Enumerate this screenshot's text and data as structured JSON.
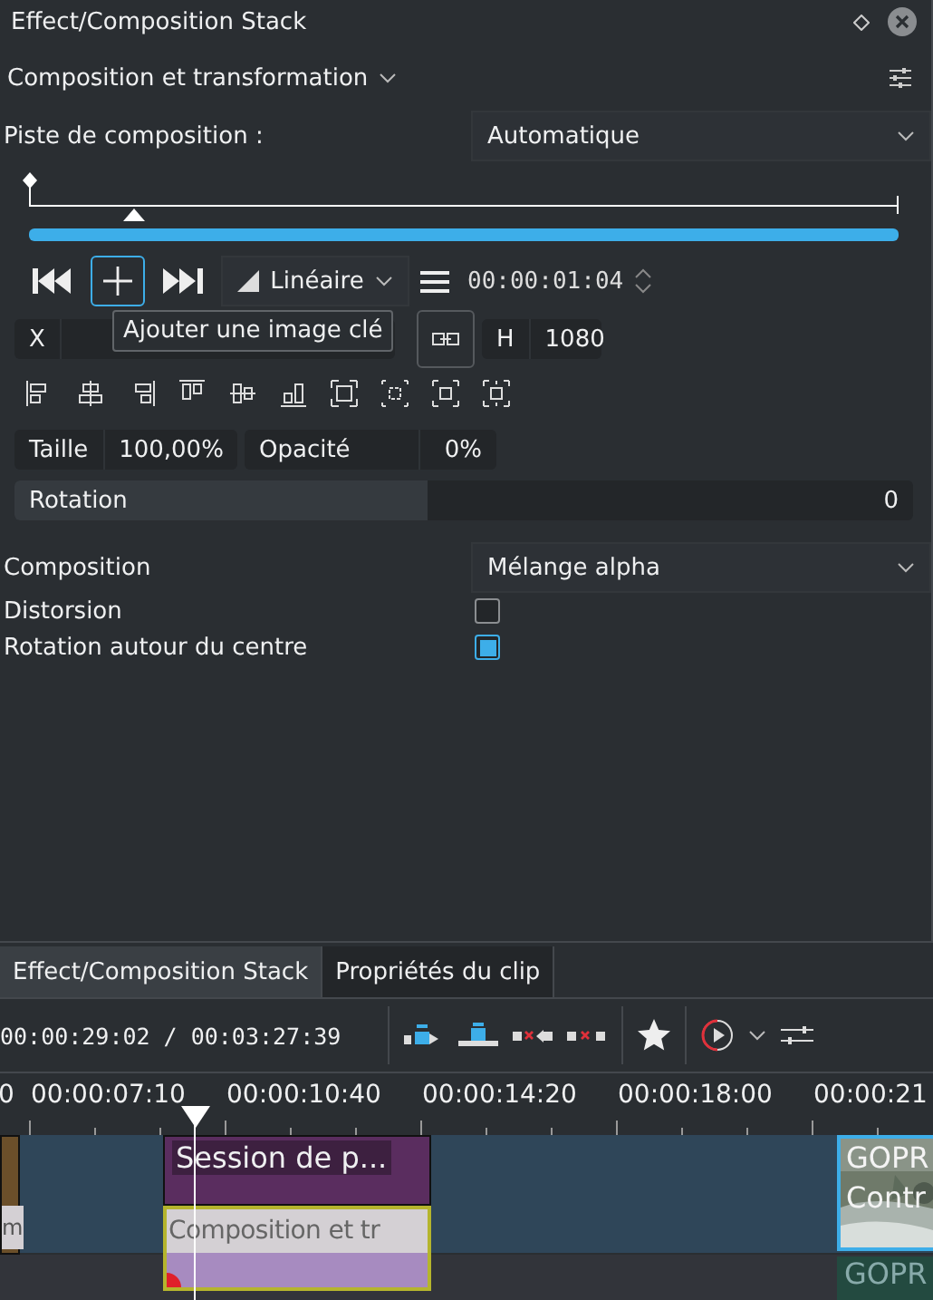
{
  "panel": {
    "title": "Effect/Composition Stack",
    "effect": {
      "name": "Composition et transformation"
    },
    "track": {
      "label": "Piste de composition :",
      "value": "Automatique"
    },
    "keyframe_ruler": {
      "level": 0.12
    },
    "keyframe_toolbar": {
      "interpolation": "Linéaire",
      "timecode": "00:00:01:04",
      "tooltip": "Ajouter une image clé"
    },
    "geometry": {
      "x_label": "X",
      "h_label": "H",
      "h_value": "1080"
    },
    "size": {
      "label": "Taille",
      "value": "100,00%"
    },
    "opacity": {
      "label": "Opacité",
      "value": "0%"
    },
    "rotation": {
      "label": "Rotation",
      "value": "0",
      "level": 0.46
    },
    "composition": {
      "label": "Composition",
      "value": "Mélange alpha"
    },
    "options": [
      {
        "label": "Distorsion",
        "checked": false
      },
      {
        "label": "Rotation autour du centre",
        "checked": true
      }
    ]
  },
  "tabs": [
    {
      "label": "Effect/Composition Stack",
      "selected": true
    },
    {
      "label": "Propriétés du clip",
      "selected": false
    }
  ],
  "timeline": {
    "timecode": "00:00:29:02 / 00:03:27:39",
    "ruler": [
      "0",
      "00:00:07:10",
      "00:00:10:40",
      "00:00:14:20",
      "00:00:18:00",
      "00:00:21"
    ],
    "clips": [
      {
        "kind": "edge",
        "label": "m"
      },
      {
        "kind": "video",
        "title": "Session de p...",
        "composition": "Composition et tr"
      },
      {
        "kind": "gopro",
        "lines": [
          "GOPR",
          "Contr"
        ],
        "audio": "GOPR"
      }
    ]
  }
}
